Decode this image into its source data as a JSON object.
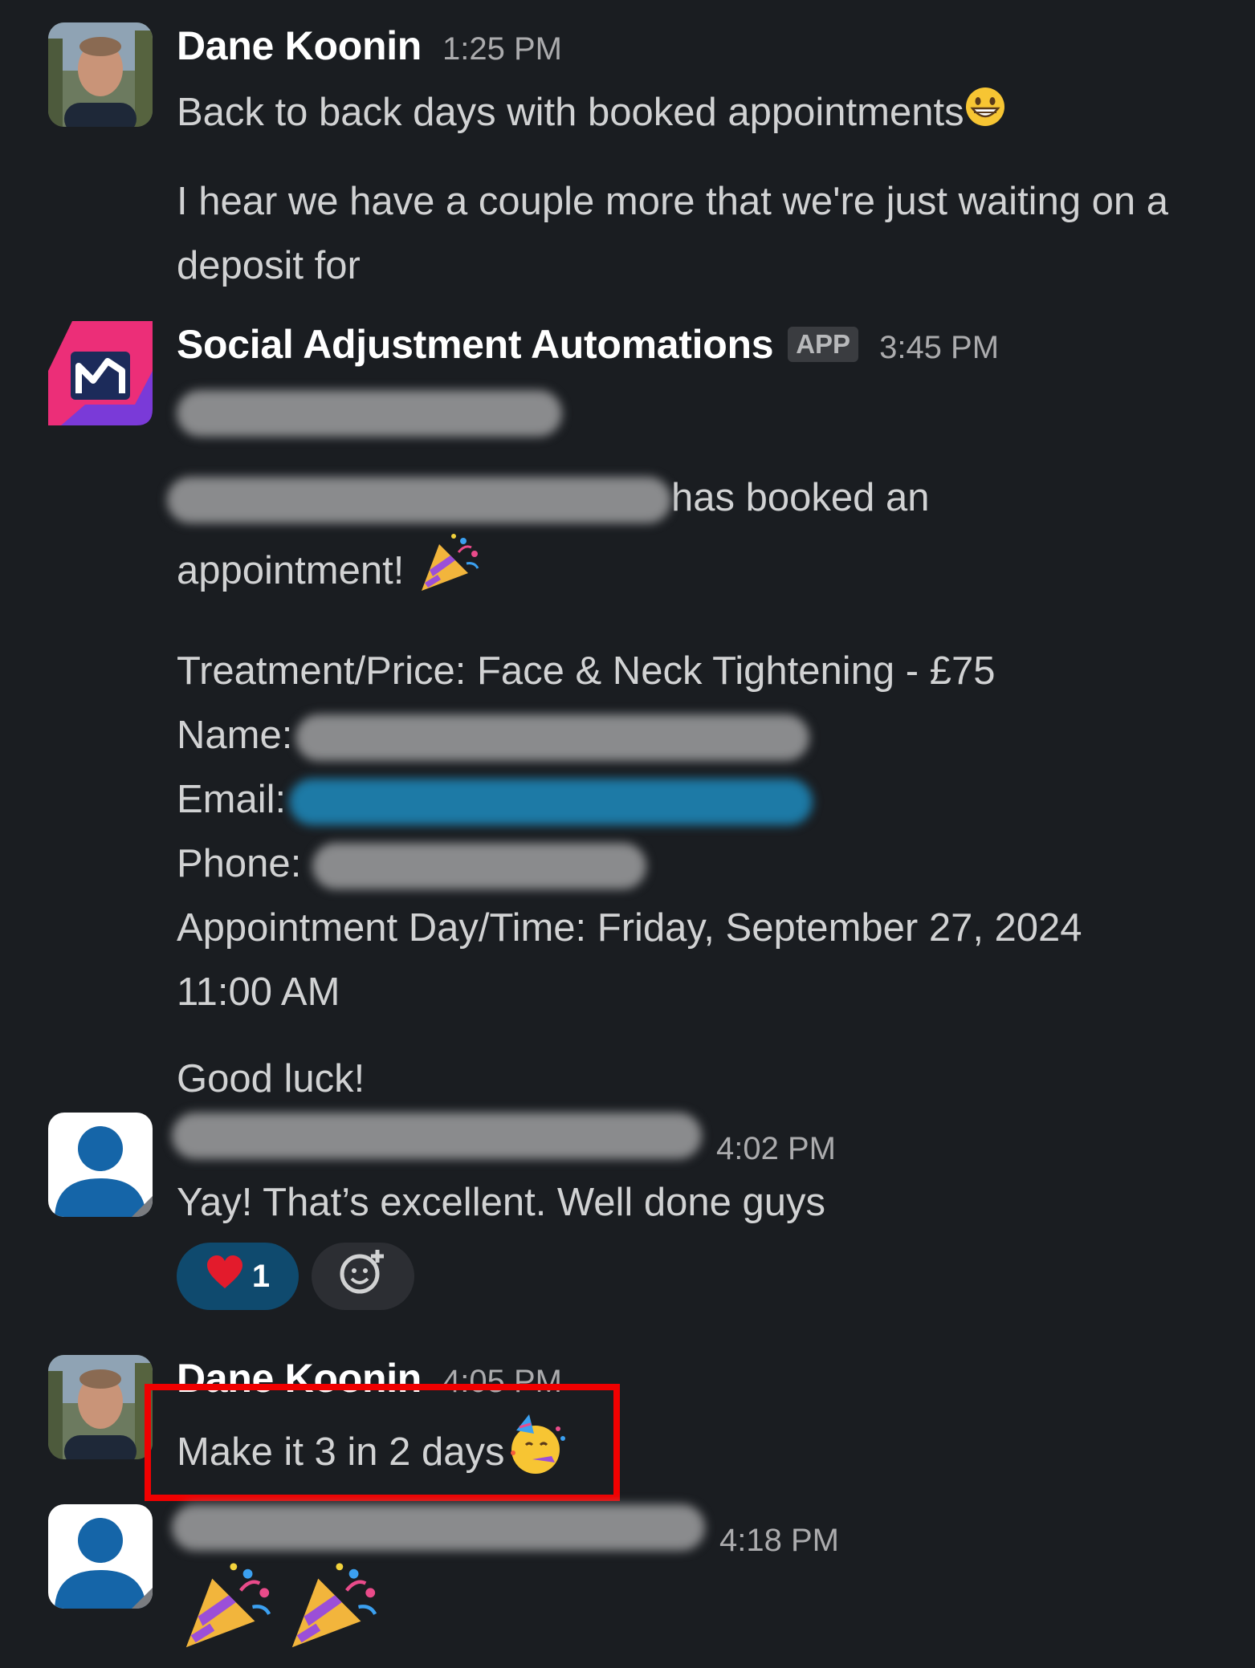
{
  "messages": [
    {
      "sender": "Dane Koonin",
      "time": "1:25 PM",
      "lines": [
        "Back to back days with booked appointments",
        "I hear we have a couple more that we're just waiting on a deposit for"
      ],
      "emoji": "grinning-face"
    },
    {
      "sender": "Social Adjustment Automations",
      "badge": "APP",
      "time": "3:45 PM",
      "booked_text": "has booked an",
      "booked_text_2": "appointment!",
      "details": {
        "treatment": "Treatment/Price: Face & Neck Tightening - £75",
        "name_label": "Name:",
        "email_label": "Email:",
        "phone_label": "Phone:",
        "appointment_line1": "Appointment Day/Time: Friday, September 27, 2024",
        "appointment_line2": "11:00 AM"
      },
      "closing": "Good luck!"
    },
    {
      "time": "4:02 PM",
      "text": "Yay! That’s excellent. Well done guys",
      "reactions": [
        {
          "emoji": "red-heart",
          "count": "1"
        }
      ]
    },
    {
      "sender": "Dane Koonin",
      "time": "4:05 PM",
      "text": "Make it 3 in 2 days",
      "emoji": "partying-face"
    },
    {
      "time": "4:18 PM",
      "emoji": "party-popper"
    }
  ],
  "colors": {
    "background": "#1a1d21",
    "highlight": "#f00000",
    "reaction_active": "#0f4a6e"
  }
}
